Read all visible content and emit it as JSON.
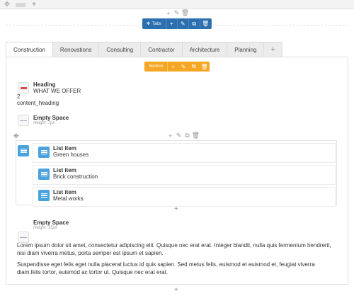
{
  "top_controls": {
    "plus": "+",
    "pencil": "✎",
    "trash": "🗑"
  },
  "tabs_element": {
    "label": "Tabs",
    "move_glyph": "✥"
  },
  "tabs": [
    {
      "label": "Construction",
      "active": true
    },
    {
      "label": "Renovations"
    },
    {
      "label": "Consulting"
    },
    {
      "label": "Contractor"
    },
    {
      "label": "Architecture"
    },
    {
      "label": "Planning"
    }
  ],
  "add_tab": "+",
  "section_element": {
    "label": "Section"
  },
  "heading_element": {
    "title": "Heading",
    "text": "WHAT WE OFFER",
    "level": "2",
    "class": "content_heading"
  },
  "empty_space_1": {
    "title": "Empty Space",
    "meta": "Height: 7px"
  },
  "list_items": [
    {
      "title": "List item",
      "text": "Green houses"
    },
    {
      "title": "List item",
      "text": "Brick construction"
    },
    {
      "title": "List item",
      "text": "Metal works"
    }
  ],
  "empty_space_2": {
    "title": "Empty Space",
    "meta": "Height: 15px"
  },
  "paragraphs": [
    "Lorem ipsum dolor sit amet, consectetur adipiscing elit. Quisque nec erat erat. Integer blandit, nulla quis fermentum hendrerit, nisi diam viverra metus, porta semper est ipsum et sapien.",
    "Suspendisse eget felis eget nulla placerat luctus id quis sapien. Sed metus felis, euismod et euismod et, feugiat viverra diam.felis tortor, euismod ac tortor ut. Quisque nec erat erat."
  ],
  "glyphs": {
    "plus": "+",
    "move": "✥",
    "pencil": "✎",
    "copy": "⧉",
    "trash": "🗑"
  }
}
